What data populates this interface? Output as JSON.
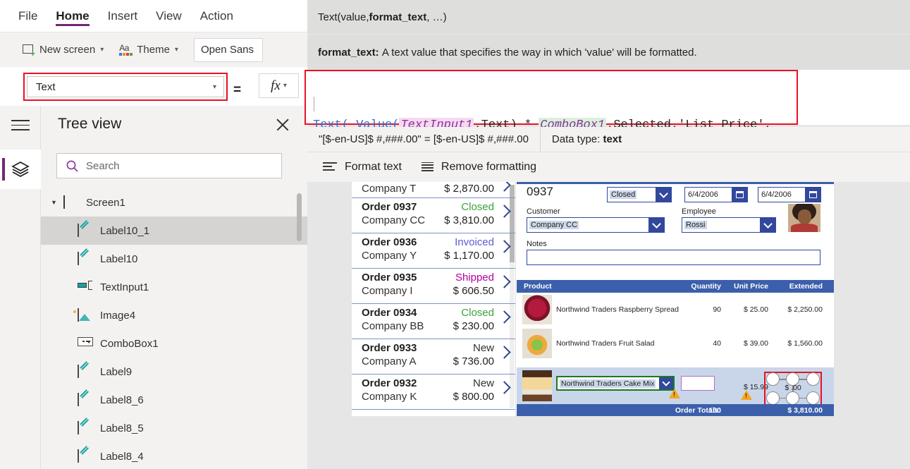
{
  "menu": {
    "items": [
      "File",
      "Home",
      "Insert",
      "View",
      "Action"
    ],
    "active": "Home"
  },
  "ribbon": {
    "new_screen": "New screen",
    "theme": "Theme",
    "font_value": "Open Sans"
  },
  "property_bar": {
    "selected_property": "Text",
    "equals": "=",
    "fx_label": "fx"
  },
  "intellisense": {
    "signature_prefix": "Text(value, ",
    "signature_bold": "format_text",
    "signature_suffix": ", …)",
    "desc_bold": "format_text:",
    "desc_text": "A text value that specifies the way in which 'value' will be formatted."
  },
  "formula": {
    "line1": [
      {
        "t": "Text( ",
        "c": "f-fn"
      },
      {
        "t": "Value(",
        "c": "f-fn"
      },
      {
        "t": "TextInput1",
        "c": "f-ctrl-p"
      },
      {
        "t": ".Text) * ",
        "c": "f-plain"
      },
      {
        "t": "ComboBox1",
        "c": "f-ctrl-g"
      },
      {
        "t": ".Selected.'List Price',",
        "c": "f-plain"
      }
    ],
    "line2": [
      {
        "t": "    ",
        "c": "f-plain"
      },
      {
        "t": "\"[$-en-US]$ #,###.00\"",
        "c": "f-str"
      },
      {
        "t": " )",
        "c": "f-plain"
      }
    ]
  },
  "result_bar": {
    "expression": "\"[$-en-US]$ #,###.00\"  =  [$-en-US]$ #,###.00",
    "datatype_label": "Data type:",
    "datatype_value": "text"
  },
  "format_bar": {
    "format_text": "Format text",
    "remove_formatting": "Remove formatting"
  },
  "tree_view": {
    "title": "Tree view",
    "search_placeholder": "Search",
    "root": "Screen1",
    "items": [
      {
        "label": "Label10_1",
        "icon": "label-icon",
        "selected": true
      },
      {
        "label": "Label10",
        "icon": "label-icon",
        "selected": false
      },
      {
        "label": "TextInput1",
        "icon": "textinput-icon",
        "selected": false
      },
      {
        "label": "Image4",
        "icon": "image-icon",
        "selected": false
      },
      {
        "label": "ComboBox1",
        "icon": "combobox-icon",
        "selected": false
      },
      {
        "label": "Label9",
        "icon": "label-icon",
        "selected": false
      },
      {
        "label": "Label8_6",
        "icon": "label-icon",
        "selected": false
      },
      {
        "label": "Label8_5",
        "icon": "label-icon",
        "selected": false
      },
      {
        "label": "Label8_4",
        "icon": "label-icon",
        "selected": false
      }
    ]
  },
  "canvas": {
    "gallery": [
      {
        "order": "",
        "company": "Company T",
        "status": "",
        "status_color": "#201f1e",
        "amount": "$ 2,870.00",
        "clipped": true
      },
      {
        "order": "Order 0937",
        "company": "Company CC",
        "status": "Closed",
        "status_color": "#3aa33a",
        "amount": "$ 3,810.00"
      },
      {
        "order": "Order 0936",
        "company": "Company Y",
        "status": "Invoiced",
        "status_color": "#5b5bd6",
        "amount": "$ 1,170.00"
      },
      {
        "order": "Order 0935",
        "company": "Company I",
        "status": "Shipped",
        "status_color": "#b4009e",
        "amount": "$ 606.50"
      },
      {
        "order": "Order 0934",
        "company": "Company BB",
        "status": "Closed",
        "status_color": "#3aa33a",
        "amount": "$ 230.00"
      },
      {
        "order": "Order 0933",
        "company": "Company A",
        "status": "New",
        "status_color": "#323130",
        "amount": "$ 736.00"
      },
      {
        "order": "Order 0932",
        "company": "Company K",
        "status": "New",
        "status_color": "#323130",
        "amount": "$ 800.00"
      }
    ],
    "detail": {
      "order_number": "0937",
      "status_value": "Closed",
      "date1": "6/4/2006",
      "date2": "6/4/2006",
      "customer_label": "Customer",
      "customer_value": "Company CC",
      "employee_label": "Employee",
      "employee_value": "Rossi",
      "notes_label": "Notes",
      "notes_value": ""
    },
    "product_table": {
      "headers": [
        "Product",
        "Quantity",
        "Unit Price",
        "Extended"
      ],
      "rows": [
        {
          "name": "Northwind Traders Raspberry Spread",
          "qty": "90",
          "unit_price": "$ 25.00",
          "extended": "$ 2,250.00",
          "thumb": "raspberry-spread-thumb"
        },
        {
          "name": "Northwind Traders Fruit Salad",
          "qty": "40",
          "unit_price": "$ 39.00",
          "extended": "$ 1,560.00",
          "thumb": "fruit-salad-thumb"
        }
      ],
      "edit_row": {
        "product_value": "Northwind Traders Cake Mix",
        "qty_value": "",
        "unit_price": "$ 15.99",
        "extended_selected_value": "$ .00",
        "thumb": "cake-mix-thumb"
      },
      "totals": {
        "label": "Order Totals:",
        "qty": "130",
        "extended": "$ 3,810.00"
      }
    }
  },
  "colors": {
    "brand_purple": "#742774",
    "selection_red": "#e81123",
    "form_blue": "#3b5fab",
    "teal_icon": "#13a3a3"
  }
}
